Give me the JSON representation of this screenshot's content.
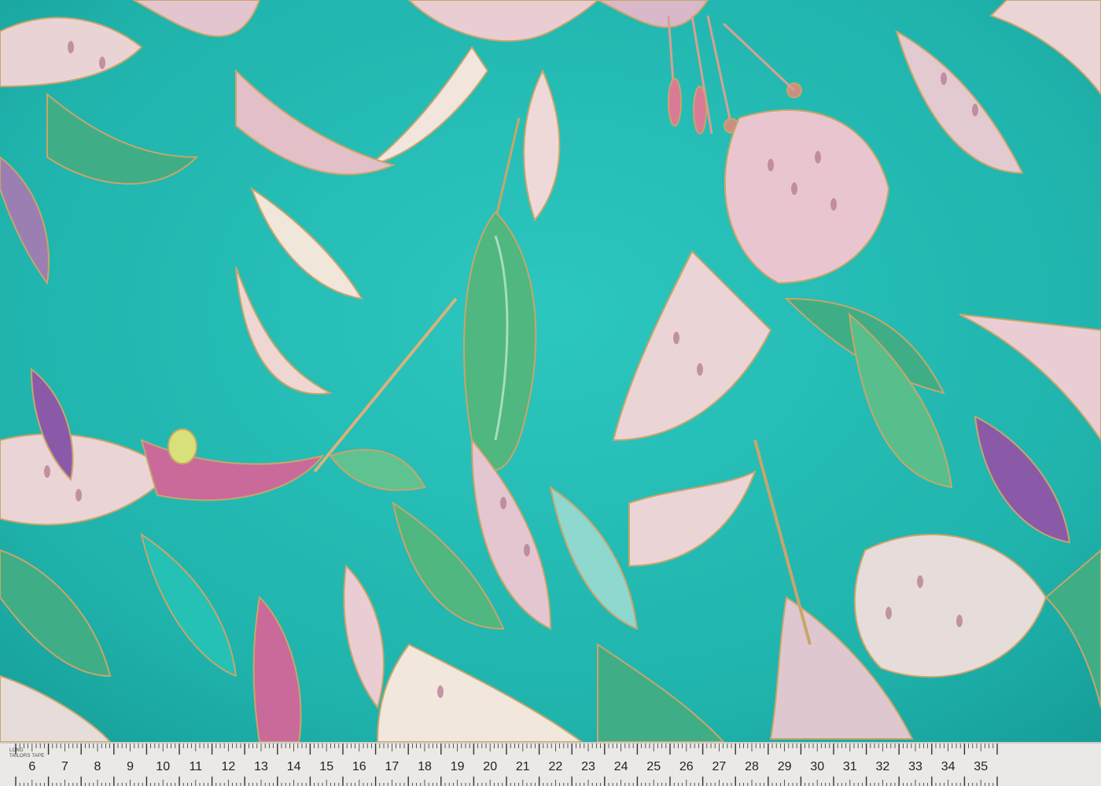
{
  "image": {
    "subject": "Teal fabric with lily print and metallic outlines, measured by a tailor's tape",
    "colors": {
      "background": "#1fb7b0",
      "petal_pink": "#e9c6cf",
      "petal_cream": "#f1e7dc",
      "magenta": "#c96a9a",
      "purple": "#8a5aa8",
      "leaf_green": "#4bb57d",
      "gold": "#c9a56a",
      "tape": "#eae9e6"
    }
  },
  "tape": {
    "brand_top": "LONG",
    "brand_bottom": "TAILORS TAPE",
    "numbers": [
      "6",
      "7",
      "8",
      "9",
      "10",
      "11",
      "12",
      "13",
      "14",
      "15",
      "16",
      "17",
      "18",
      "19",
      "20",
      "21",
      "22",
      "23",
      "24",
      "25",
      "26",
      "27",
      "28",
      "29",
      "30",
      "31",
      "32",
      "33",
      "34",
      "35"
    ]
  }
}
